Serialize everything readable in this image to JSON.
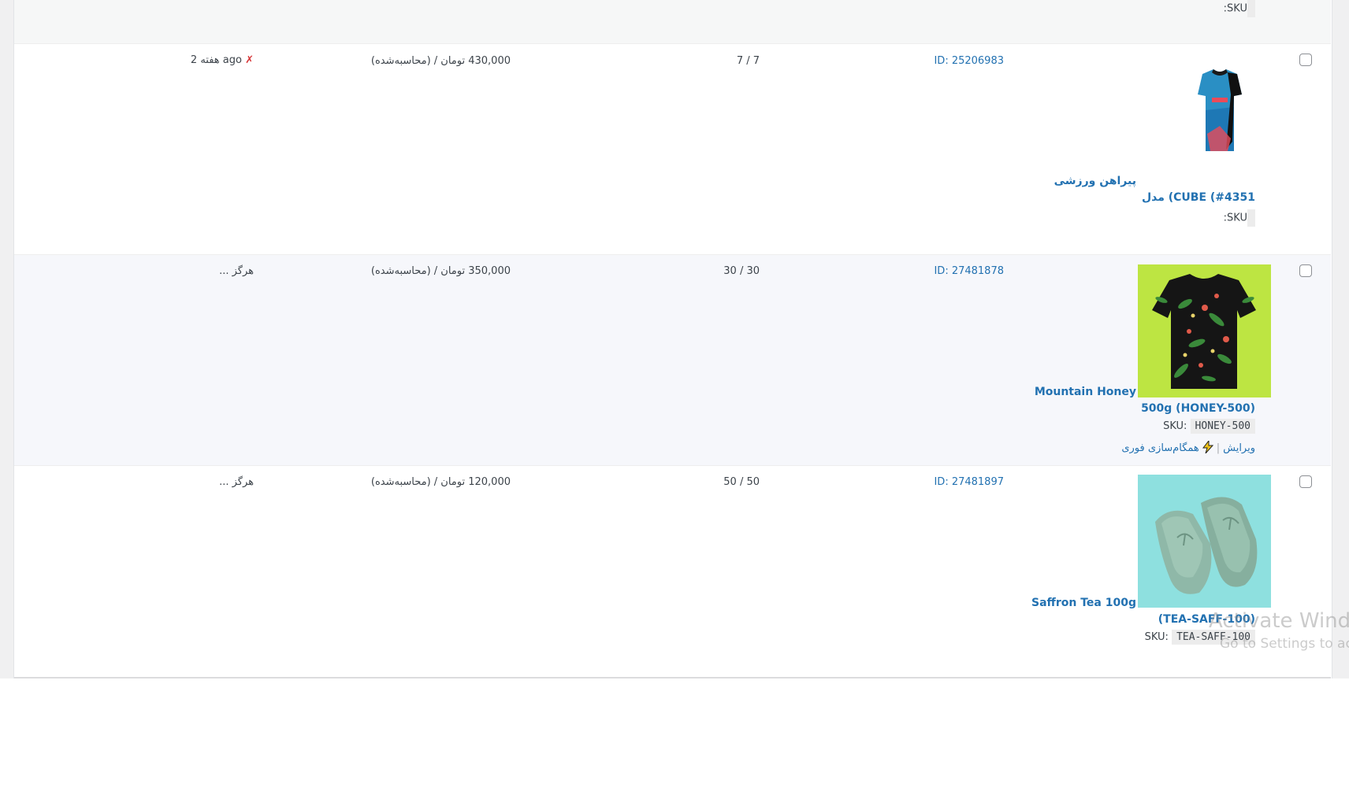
{
  "top_row": {
    "sku_label": ":SKU"
  },
  "rows": [
    {
      "product_title": "مدل (CUBE (#4351",
      "parent_title": "پیراهن ورزشی",
      "sku_label": ":SKU",
      "sku_value": "",
      "id": "ID: 25206983",
      "stock": "7 / 7",
      "price": "430,000 تومان / (محاسبه‌شده)",
      "sync_mark": "✗",
      "sync_text": "2 هفته ago"
    },
    {
      "product_title": "500g (HONEY-500)",
      "parent_title": "Mountain Honey",
      "sku_label": "SKU:",
      "sku_value": "HONEY-500",
      "edit_link": "ویرایش",
      "separator": "|",
      "sync_link": "همگام‌سازی فوری",
      "id": "ID: 27481878",
      "stock": "30 / 30",
      "price": "350,000 تومان / (محاسبه‌شده)",
      "sync_text": "... هرگز"
    },
    {
      "product_title": "(TEA-SAFF-100)",
      "parent_title": "Saffron Tea 100g",
      "sku_label": "SKU:",
      "sku_value": "TEA-SAFF-100",
      "id": "ID: 27481897",
      "stock": "50 / 50",
      "price": "120,000 تومان / (محاسبه‌شده)",
      "sync_text": "... هرگز"
    }
  ],
  "watermark": {
    "line1": "Activate Windows",
    "line2": "Go to Settings to activate Windows."
  },
  "colors": {
    "link": "#2271b1",
    "error": "#d63638",
    "alt_row": "#f6f7fb"
  },
  "icons": [
    "lightning-icon",
    "checkbox",
    "product-thumbnail"
  ]
}
